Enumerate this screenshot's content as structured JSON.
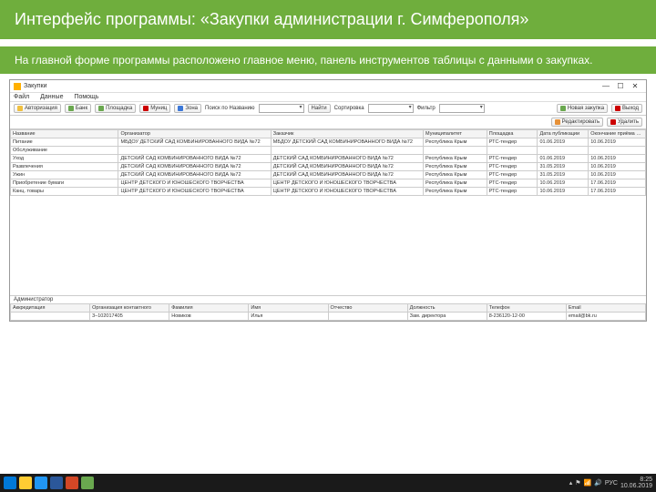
{
  "slide": {
    "title": "Интерфейс программы: «Закупки администрации г. Симферополя»",
    "subtitle": "На главной форме программы расположено главное меню, панель инструментов таблицы с данными о закупках."
  },
  "window": {
    "title": "Закупки",
    "minimize": "—",
    "maximize": "☐",
    "close": "✕"
  },
  "menubar": {
    "items": [
      "Файл",
      "Данные",
      "Помощь"
    ]
  },
  "toolbar": {
    "auth": "Авторизация",
    "bank": "Банк",
    "sq": "Площадка",
    "muni": "Муниц",
    "zone": "Зона",
    "search_label": "Поиск по Названию",
    "search_btn": "Найти",
    "sort_label": "Сортировка",
    "filter_label": "Фильтр",
    "new": "Новая закупка",
    "exit": "Выход",
    "edit": "Редактировать",
    "delete": "Удалить"
  },
  "grid": {
    "headers": [
      "Название",
      "Организатор",
      "Заказчик",
      "Муниципалитет",
      "Площадка",
      "Дата публикации",
      "Окончание приёма заявок"
    ],
    "widths": [
      "17%",
      "24%",
      "24%",
      "10%",
      "8%",
      "8%",
      "9%"
    ],
    "rows": [
      [
        "Питание",
        "МБДОУ ДЕТСКИЙ САД КОМБИНИРОВАННОГО ВИДА №72",
        "МБДОУ ДЕТСКИЙ САД КОМБИНИРОВАННОГО ВИДА №72",
        "Республика Крым",
        "РТС-тендер",
        "01.06.2019",
        "10.06.2019"
      ],
      [
        "Обслуживание",
        "",
        "",
        "",
        "",
        "",
        ""
      ],
      [
        "Уход",
        "ДЕТСКИЙ САД КОМБИНИРОВАННОГО ВИДА №72",
        "ДЕТСКИЙ САД КОМБИНИРОВАННОГО ВИДА №72",
        "Республика Крым",
        "РТС-тендер",
        "01.06.2019",
        "10.06.2019"
      ],
      [
        "Развлечения",
        "ДЕТСКИЙ САД КОМБИНИРОВАННОГО ВИДА №72",
        "ДЕТСКИЙ САД КОМБИНИРОВАННОГО ВИДА №72",
        "Республика Крым",
        "РТС-тендер",
        "31.05.2019",
        "10.06.2019"
      ],
      [
        "Ужин",
        "ДЕТСКИЙ САД КОМБИНИРОВАННОГО ВИДА №72",
        "ДЕТСКИЙ САД КОМБИНИРОВАННОГО ВИДА №72",
        "Республика Крым",
        "РТС-тендер",
        "31.05.2019",
        "10.06.2019"
      ],
      [
        "Приобретение бумаги",
        "ЦЕНТР ДЕТСКОГО И ЮНОШЕСКОГО ТВОРЧЕСТВА",
        "ЦЕНТР ДЕТСКОГО И ЮНОШЕСКОГО ТВОРЧЕСТВА",
        "Республика Крым",
        "РТС-тендер",
        "10.06.2019",
        "17.06.2019"
      ],
      [
        "Канц. товары",
        "ЦЕНТР ДЕТСКОГО И ЮНОШЕСКОГО ТВОРЧЕСТВА",
        "ЦЕНТР ДЕТСКОГО И ЮНОШЕСКОГО ТВОРЧЕСТВА",
        "Республика Крым",
        "РТС-тендер",
        "10.06.2019",
        "17.06.2019"
      ]
    ]
  },
  "admin": {
    "label": "Администратор",
    "headers": [
      "Аккредитация",
      "Организация контактного",
      "Фамилия",
      "Имя",
      "Отчество",
      "Должность",
      "Телефон",
      "Email"
    ],
    "row": [
      "",
      "3–102017405",
      "Новиков",
      "Илья",
      "",
      "Зам. директора",
      "8-236120-12-00",
      "email@bk.ru"
    ]
  },
  "taskbar": {
    "lang": "РУС",
    "time": "8:25",
    "date": "10.06.2019"
  }
}
